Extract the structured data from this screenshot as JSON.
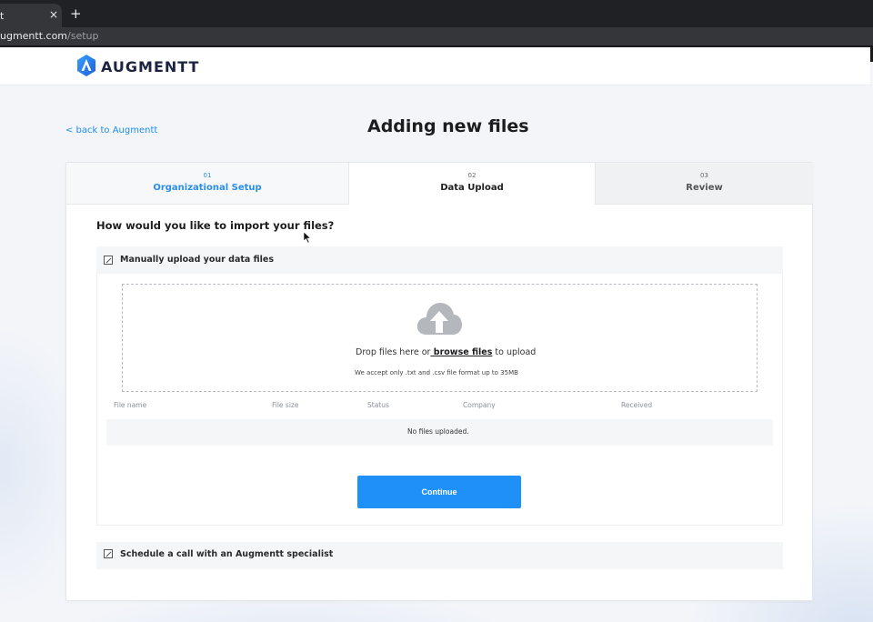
{
  "browser": {
    "tab_title": "t",
    "tab_close": "×",
    "new_tab": "+",
    "url_host": "ugmentt.com",
    "url_path": "/setup"
  },
  "header": {
    "brand": "AUGMENTT",
    "brand_color": "#1b2340",
    "accent_color": "#1e90f7"
  },
  "page": {
    "back_link": "< back to Augmentt",
    "title": "Adding new files"
  },
  "steps": [
    {
      "number": "01",
      "label": "Organizational Setup",
      "state": "completed"
    },
    {
      "number": "02",
      "label": "Data Upload",
      "state": "active"
    },
    {
      "number": "03",
      "label": "Review",
      "state": "upcoming"
    }
  ],
  "import": {
    "question": "How would you like to import your files?",
    "option_manual": "Manually upload your data files",
    "drop_prefix": "Drop files here or",
    "browse_label": " browse files",
    "drop_suffix": " to upload",
    "accept_note": "We accept only .txt and .csv file format up to 35MB",
    "icon": "cloud-upload-icon"
  },
  "files_table": {
    "columns": [
      "File name",
      "File size",
      "Status",
      "Company",
      "Received"
    ],
    "empty_message": "No files uploaded."
  },
  "actions": {
    "continue_label": "Continue"
  },
  "option_call": "Schedule a call with an Augmentt specialist"
}
